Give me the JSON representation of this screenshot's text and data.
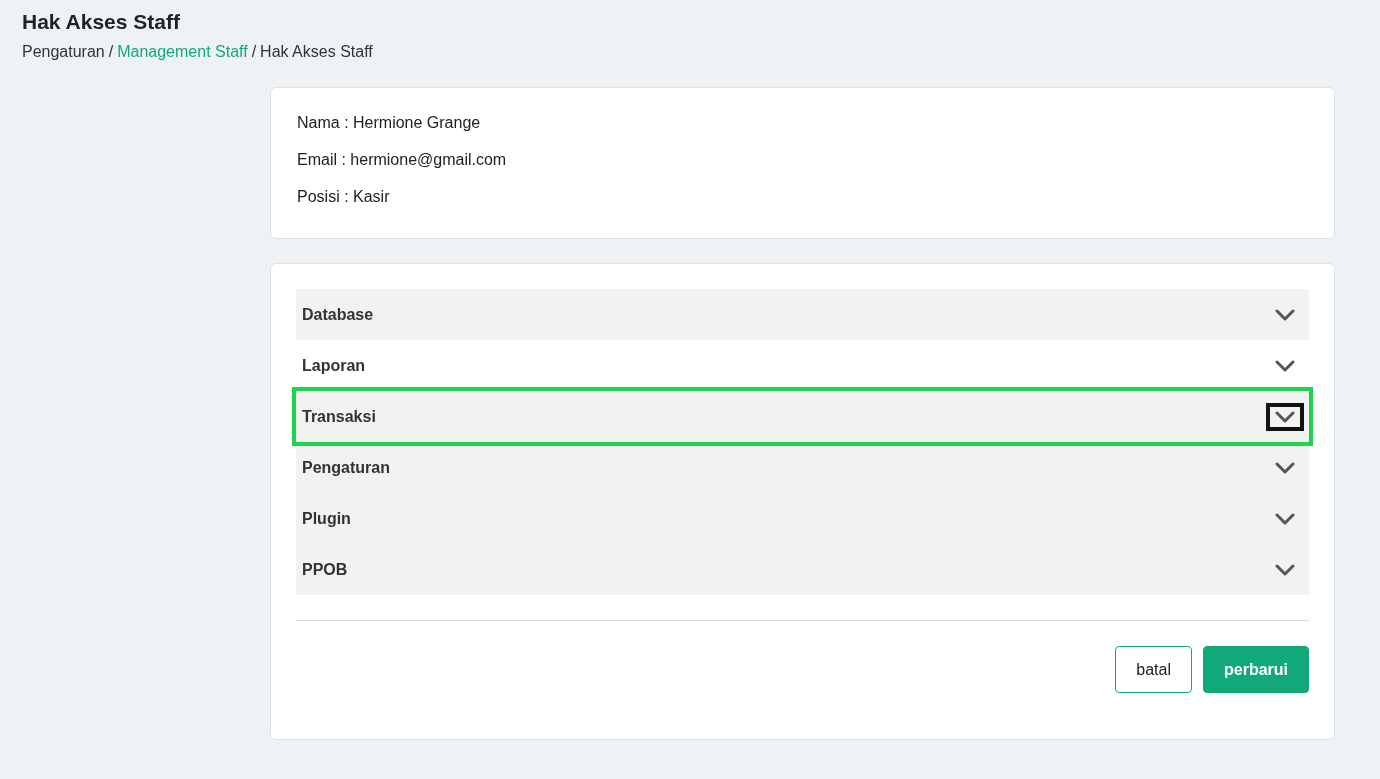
{
  "header": {
    "title": "Hak Akses Staff",
    "separator": "/",
    "breadcrumb": [
      {
        "label": "Pengaturan",
        "link": false
      },
      {
        "label": "Management Staff",
        "link": true
      },
      {
        "label": "Hak Akses Staff",
        "link": false
      }
    ]
  },
  "profile": [
    "Nama : Hermione Grange",
    "Email : hermione@gmail.com",
    "Posisi : Kasir"
  ],
  "permissions": [
    {
      "label": "Database",
      "shaded": true,
      "highlighted": false
    },
    {
      "label": "Laporan",
      "shaded": false,
      "highlighted": false
    },
    {
      "label": "Transaksi",
      "shaded": true,
      "highlighted": true
    },
    {
      "label": "Pengaturan",
      "shaded": true,
      "highlighted": false
    },
    {
      "label": "Plugin",
      "shaded": true,
      "highlighted": false
    },
    {
      "label": "PPOB",
      "shaded": true,
      "highlighted": false
    }
  ],
  "buttons": [
    {
      "label": "batal",
      "kind": "secondary"
    },
    {
      "label": "perbarui",
      "kind": "primary"
    }
  ]
}
